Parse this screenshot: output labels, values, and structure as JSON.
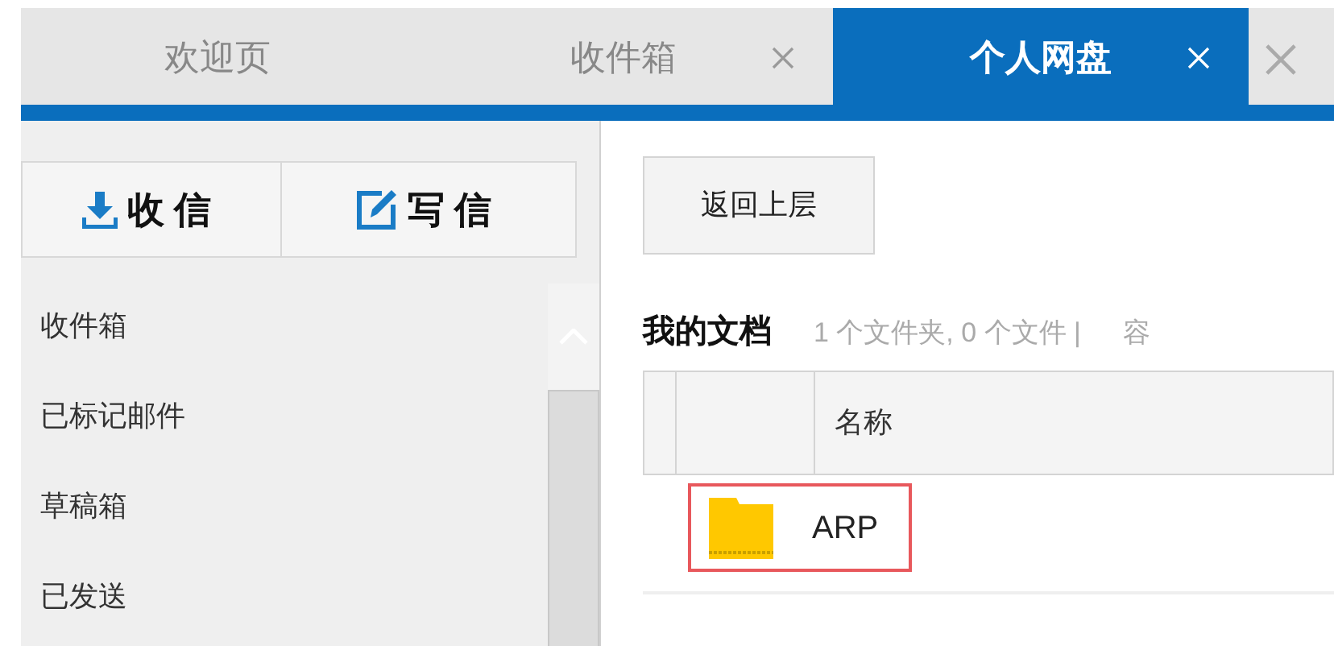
{
  "tabs": [
    {
      "label": "欢迎页",
      "selected": false,
      "closable": false
    },
    {
      "label": "收件箱",
      "selected": false,
      "closable": true
    },
    {
      "label": "个人网盘",
      "selected": true,
      "closable": true
    },
    {
      "selected": false,
      "closable": true
    }
  ],
  "sidebar": {
    "actions": [
      {
        "label": "收信",
        "kind": "receive"
      },
      {
        "label": "写信",
        "kind": "compose"
      }
    ],
    "items": [
      "收件箱",
      "已标记邮件",
      "草稿箱",
      "已发送"
    ]
  },
  "main": {
    "back_button": "返回上层",
    "title": "我的文档",
    "summary": "1 个文件夹, 0 个文件 |",
    "summary_2": "容",
    "table": {
      "columns": [
        "名称"
      ],
      "rows": [
        {
          "name": "ARP",
          "kind": "folder",
          "selected": true
        }
      ]
    }
  }
}
